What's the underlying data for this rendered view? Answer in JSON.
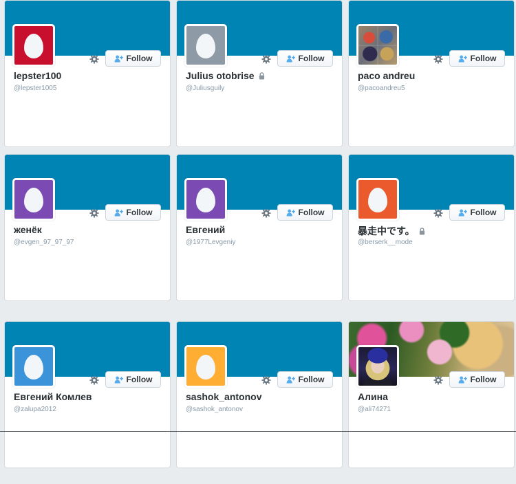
{
  "follow_label": "Follow",
  "colors": {
    "banner": "#0084b4",
    "follow_text": "#333a40",
    "name_text": "#292f33",
    "handle_text": "#8899a6"
  },
  "cards": [
    {
      "name": "lepster100",
      "handle": "@lepster1005",
      "protected": false,
      "avatar": "egg",
      "avatar_color": "#c8102e",
      "banner": "solid"
    },
    {
      "name": "Julius otobrise",
      "handle": "@Juliusguily",
      "protected": true,
      "avatar": "egg",
      "avatar_color": "#8e9aa6",
      "banner": "solid"
    },
    {
      "name": "paco andreu",
      "handle": "@pacoandreu5",
      "protected": false,
      "avatar": "photo-mosaic",
      "avatar_color": "",
      "banner": "solid"
    },
    {
      "name": "женёк",
      "handle": "@evgen_97_97_97",
      "protected": false,
      "avatar": "egg",
      "avatar_color": "#7b4bb3",
      "banner": "solid"
    },
    {
      "name": "Евгений",
      "handle": "@1977Levgeniy",
      "protected": false,
      "avatar": "egg",
      "avatar_color": "#7b4bb3",
      "banner": "solid"
    },
    {
      "name": "暴走中です。",
      "handle": "@berserk__mode",
      "protected": true,
      "avatar": "egg",
      "avatar_color": "#ea5a2c",
      "banner": "solid"
    },
    {
      "name": "Евгений Комлев",
      "handle": "@zalupa2012",
      "protected": false,
      "avatar": "egg",
      "avatar_color": "#3b94d9",
      "banner": "solid"
    },
    {
      "name": "sashok_antonov",
      "handle": "@sashok_antonov",
      "protected": false,
      "avatar": "egg",
      "avatar_color": "#ffad33",
      "banner": "solid"
    },
    {
      "name": "Алина",
      "handle": "@ali74271",
      "protected": false,
      "avatar": "photo-person",
      "avatar_color": "",
      "banner": "photo"
    }
  ]
}
